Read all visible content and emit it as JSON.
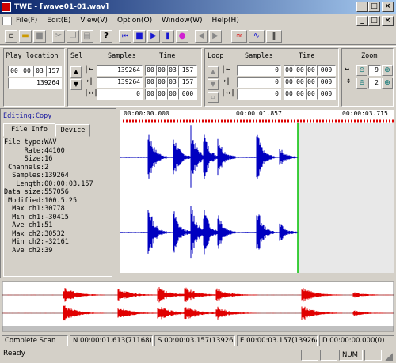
{
  "window": {
    "title": "TWE - [wave01-01.wav]",
    "min": "_",
    "max": "□",
    "close": "×"
  },
  "menu": [
    "File(F)",
    "Edit(E)",
    "View(V)",
    "Option(O)",
    "Window(W)",
    "Help(H)"
  ],
  "mdi": {
    "min": "_",
    "restore": "□",
    "close": "×"
  },
  "toolbar_icons": [
    "new-icon",
    "open-icon",
    "save-icon",
    "cut-icon",
    "copy-icon",
    "paste-icon",
    "help-icon",
    "skip-back-icon",
    "stop-icon",
    "play-icon",
    "record-icon",
    "prev-mark-icon",
    "next-mark-icon",
    "effect-icon",
    "wave-icon",
    "level-icon"
  ],
  "play": {
    "label": "Play location",
    "time": [
      "00",
      "00",
      "03",
      "157"
    ],
    "samples": "139264"
  },
  "sel": {
    "label": "Sel",
    "samples_head": "Samples",
    "time_head": "Time",
    "rows": [
      {
        "samples": "139264",
        "time": [
          "00",
          "00",
          "03",
          "157"
        ]
      },
      {
        "samples": "139264",
        "time": [
          "00",
          "00",
          "03",
          "157"
        ]
      },
      {
        "samples": "0",
        "time": [
          "00",
          "00",
          "00",
          "000"
        ]
      }
    ]
  },
  "loop": {
    "label": "Loop",
    "samples_head": "Samples",
    "time_head": "Time",
    "rows": [
      {
        "samples": "0",
        "time": [
          "00",
          "00",
          "00",
          "000"
        ]
      },
      {
        "samples": "0",
        "time": [
          "00",
          "00",
          "00",
          "000"
        ]
      },
      {
        "samples": "0",
        "time": [
          "00",
          "00",
          "00",
          "000"
        ]
      }
    ]
  },
  "zoom": {
    "label": "Zoom",
    "h": "9",
    "v": "2"
  },
  "editing": "Editing:Copy",
  "tabs": [
    "File Info",
    "Device"
  ],
  "info": [
    "File type:WAV",
    "     Rate:44100",
    "     Size:16",
    " Channels:2",
    "  Samples:139264",
    "   Length:00:00:03.157",
    "Data size:557056",
    " Modified:100.5.25",
    "  Max ch1:30778",
    "  Min ch1:-30415",
    "  Ave ch1:51",
    "  Max ch2:30532",
    "  Min ch2:-32161",
    "  Ave ch2:39"
  ],
  "ruler": {
    "t0": "00:00:00.000",
    "t1": "00:00:01.857",
    "t2": "00:00:03.715"
  },
  "colors": {
    "wave": "#0000c0",
    "overview": "#e00000",
    "cursor": "#00c000",
    "title": "#0a246a"
  },
  "status": {
    "scan": "Complete Scan",
    "n": "N 00:00:01.613(71168)",
    "s": "S 00:00:03.157(139264)",
    "e": "E 00:00:03.157(139264)",
    "d": "D 00:00:00.000(0)"
  },
  "ready": {
    "text": "Ready",
    "num": "NUM"
  }
}
